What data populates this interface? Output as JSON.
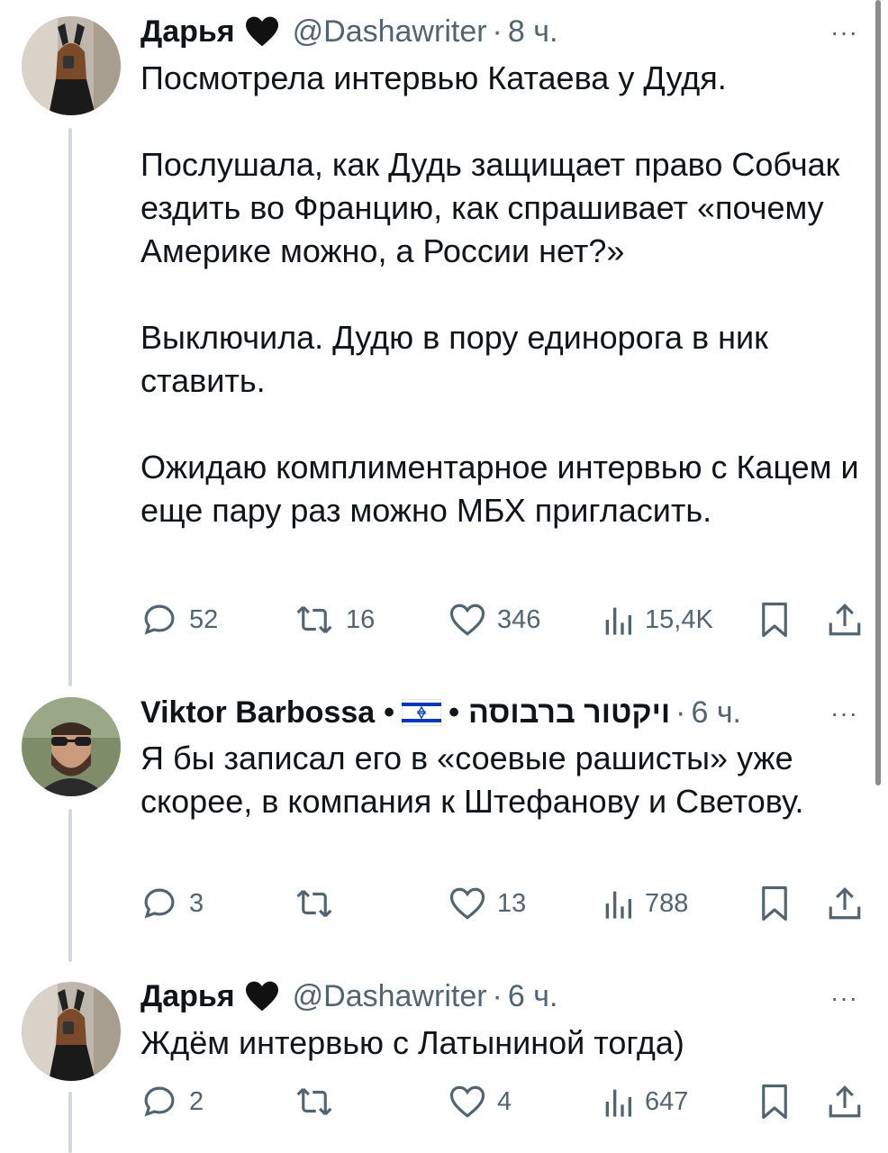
{
  "tweets": [
    {
      "name": "Дарья",
      "handle": "@Dashawriter",
      "dot": "·",
      "time": "8 ч.",
      "more": "···",
      "text": "Посмотрела интервью Катаева у Дудя.\n\nПослушала, как Дудь защищает право Собчак ездить во Францию, как спрашивает «почему Америке можно, а России нет?»\n\nВыключила. Дудю в пору единорога в ник ставить.\n\nОжидаю комплиментарное интервью с Кацем и еще пару раз можно МБХ пригласить.",
      "replies": "52",
      "retweets": "16",
      "likes": "346",
      "views": "15,4K"
    },
    {
      "name": "Viktor Barbossa",
      "sep1": "•",
      "sep2": "•",
      "name_he": "ויקטור ברבוסה",
      "dot": "·",
      "time": "6 ч.",
      "more": "···",
      "text": "Я бы записал его в «соевые рашисты» уже скорее, в компания к Штефанову и Светову.",
      "replies": "3",
      "retweets": "",
      "likes": "13",
      "views": "788"
    },
    {
      "name": "Дарья",
      "handle": "@Dashawriter",
      "dot": "·",
      "time": "6 ч.",
      "more": "···",
      "text": "Ждём интервью с Латыниной тогда)",
      "replies": "2",
      "retweets": "",
      "likes": "4",
      "views": "647"
    }
  ],
  "colors": {
    "text": "#0f1419",
    "secondary": "#536471",
    "thread_line": "#cfd9de",
    "flag_blue": "#0038b8"
  }
}
